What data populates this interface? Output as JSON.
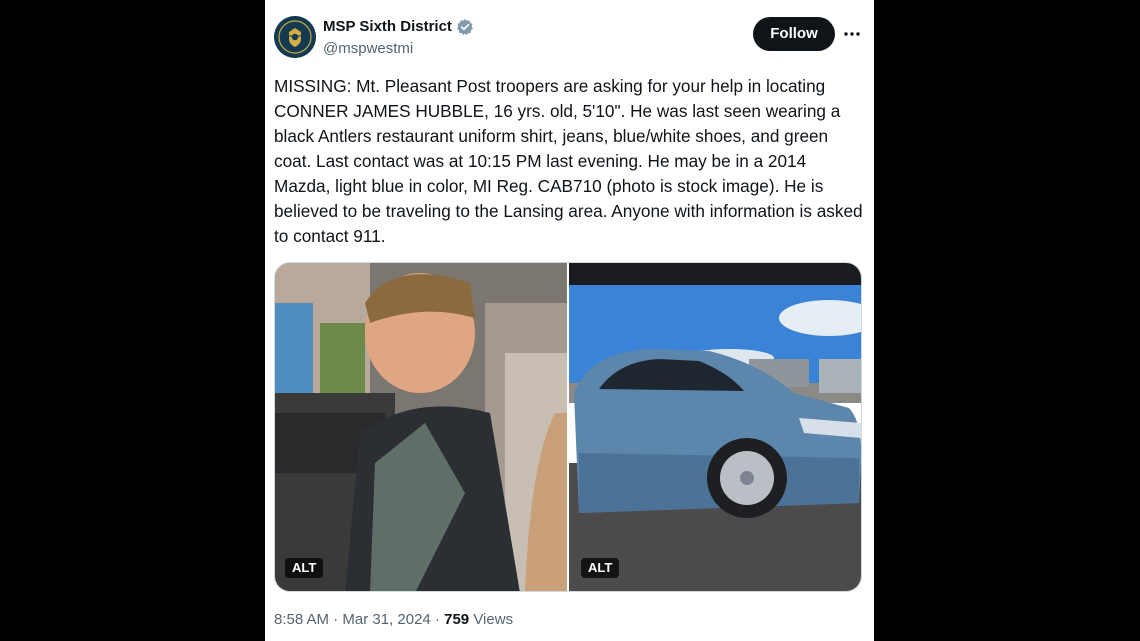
{
  "account": {
    "display_name": "MSP Sixth District",
    "handle": "@mspwestmi",
    "avatar_text_top": "WEST",
    "avatar_text_bottom": "MICHIGAN"
  },
  "actions": {
    "follow_label": "Follow",
    "more_icon": "more-horizontal-icon"
  },
  "post": {
    "text": "MISSING:  Mt. Pleasant Post troopers are asking for your help in locating CONNER JAMES HUBBLE, 16 yrs. old, 5'10\".  He was last seen wearing a black Antlers restaurant uniform shirt, jeans, blue/white shoes, and green coat. Last contact was at 10:15 PM last evening. He may be in a 2014 Mazda, light blue in color, MI Reg. CAB710 (photo is stock image). He is believed to be traveling to the Lansing area. Anyone with information is asked to contact 911.",
    "media": [
      {
        "alt_label": "ALT",
        "subject": "boy-photo"
      },
      {
        "alt_label": "ALT",
        "subject": "car-photo"
      }
    ],
    "time": "8:58 AM",
    "separator": "·",
    "date": "Mar 31, 2024",
    "views_count": "759",
    "views_label": "Views"
  },
  "colors": {
    "text_primary": "#0f1419",
    "text_secondary": "#536471",
    "verified_blue": "#829aab",
    "follow_bg": "#0f1419"
  }
}
